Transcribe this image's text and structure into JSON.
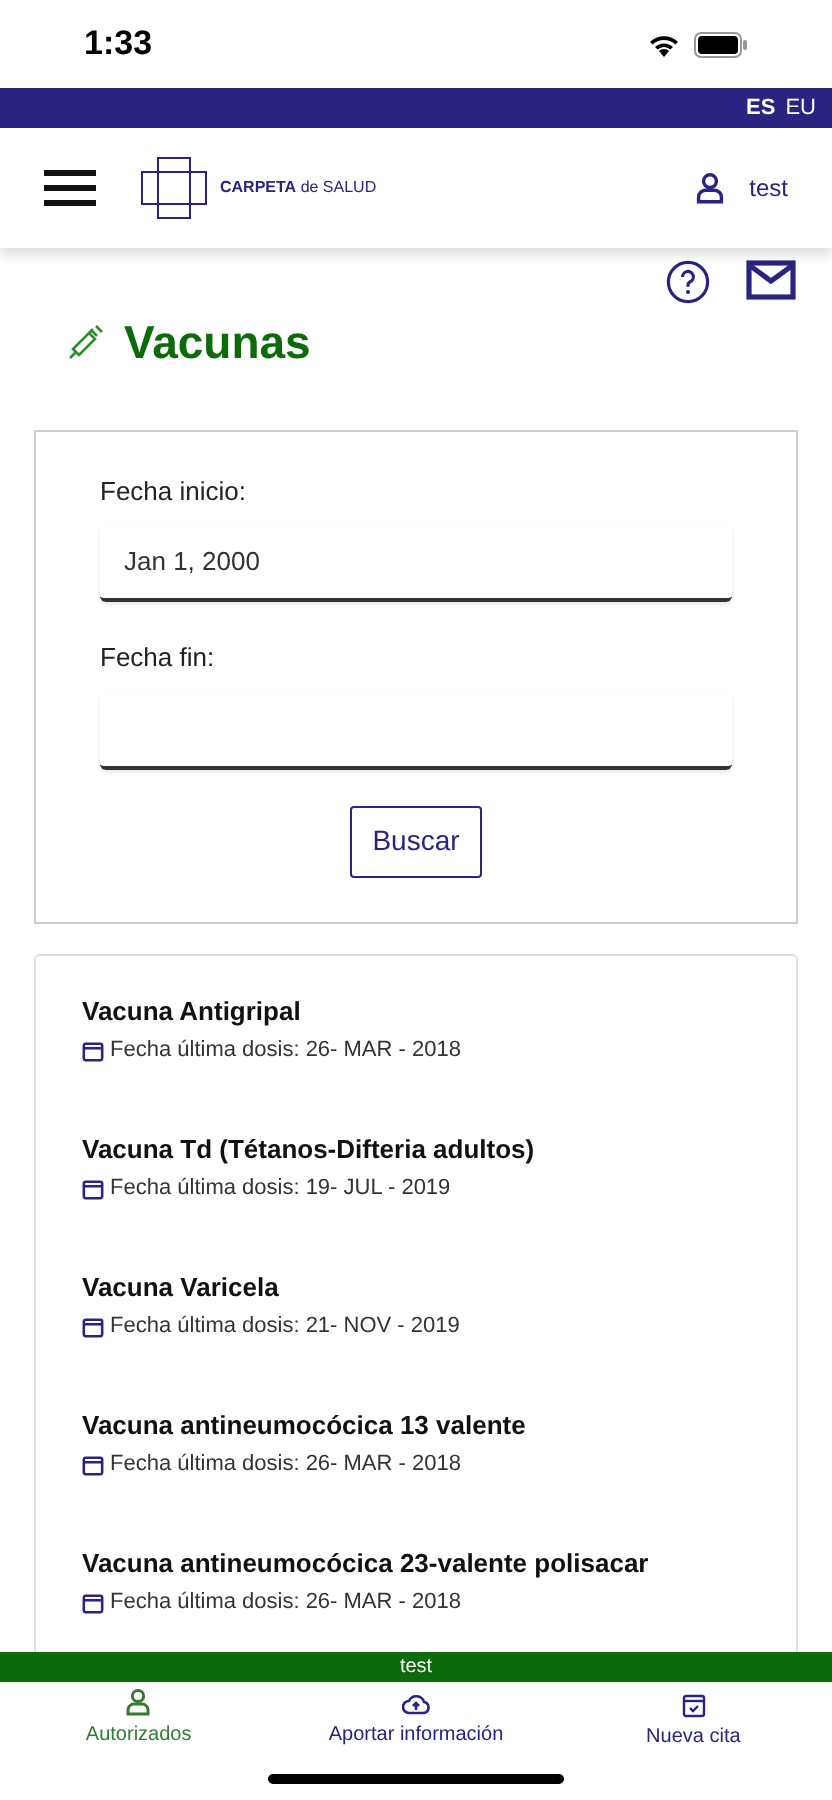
{
  "status_bar": {
    "time": "1:33"
  },
  "languages": [
    {
      "label": "ES",
      "selected": true
    },
    {
      "label": "EU",
      "selected": false
    }
  ],
  "header": {
    "logo_bold": "CARPETA",
    "logo_rest": "de SALUD",
    "user": "test"
  },
  "page_title": "Vacunas",
  "form": {
    "fields": [
      {
        "label": "Fecha inicio:",
        "value": "Jan 1, 2000"
      },
      {
        "label": "Fecha fin:"
      }
    ],
    "button": "Buscar"
  },
  "vaccines": [
    {
      "name": "Vacuna Antigripal",
      "date": "Fecha última dosis: 26- MAR - 2018"
    },
    {
      "name": "Vacuna Td (Tétanos-Difteria adultos)",
      "date": "Fecha última dosis: 19- JUL - 2019"
    },
    {
      "name": "Vacuna Varicela",
      "date": "Fecha última dosis: 21- NOV - 2019"
    },
    {
      "name": "Vacuna antineumocócica 13 valente",
      "date": "Fecha última dosis: 26- MAR - 2018"
    },
    {
      "name": "Vacuna antineumocócica 23-valente polisacar",
      "date": "Fecha última dosis: 26- MAR - 2018"
    }
  ],
  "user_banner": "test",
  "bottom_nav": [
    {
      "label": "Autorizados",
      "kind": "person",
      "selected": true
    },
    {
      "label": "Aportar información",
      "kind": "upload",
      "selected": false
    },
    {
      "label": "Nueva cita",
      "kind": "calendar",
      "selected": false
    }
  ]
}
